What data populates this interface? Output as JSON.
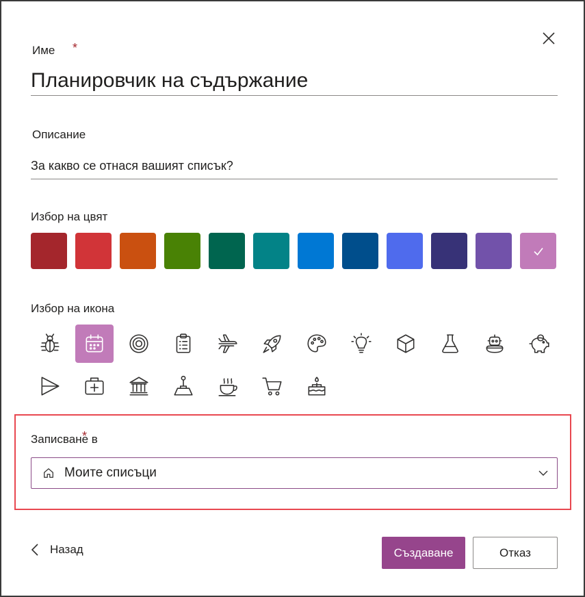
{
  "form": {
    "name_label": "Име",
    "required_mark": "*",
    "name_value": "Планировчик на съдържание",
    "description_label": "Описание",
    "description_placeholder": "За какво се отнася вашият списък?",
    "color_label": "Избор на цвят",
    "colors": [
      "#a4262c",
      "#d13438",
      "#ca5010",
      "#498205",
      "#00654f",
      "#038387",
      "#0078d4",
      "#004e8c",
      "#4f6bed",
      "#373277",
      "#7252aa",
      "#c17bb9"
    ],
    "selected_color_index": 11,
    "icon_label": "Избор на икона",
    "icons": [
      "bug-icon",
      "calendar-icon",
      "target-icon",
      "clipboard-list-icon",
      "airplane-icon",
      "rocket-icon",
      "palette-icon",
      "lightbulb-icon",
      "cube-icon",
      "flask-icon",
      "robot-icon",
      "piggy-bank-icon",
      "paper-plane-icon",
      "medkit-icon",
      "bank-icon",
      "joystick-icon",
      "coffee-cup-icon",
      "shopping-cart-icon",
      "cake-icon"
    ],
    "selected_icon_index": 1,
    "save_to_label": "Записване в",
    "save_to_value": "Моите списъци",
    "save_to_icon": "home-icon"
  },
  "footer": {
    "back_label": "Назад",
    "create_label": "Създаване",
    "cancel_label": "Отказ"
  },
  "accent": "#96458c",
  "highlight_color": "#e8474f"
}
